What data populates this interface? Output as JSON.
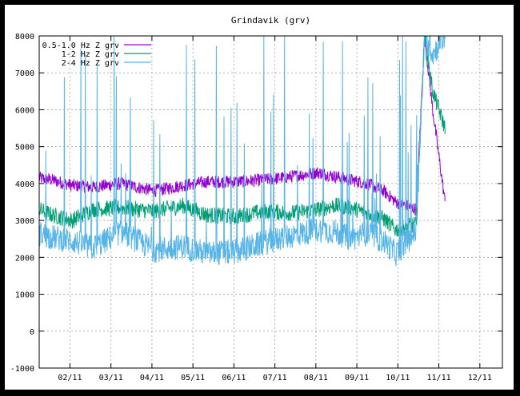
{
  "chart_data": {
    "type": "line",
    "title": "Grindavik (grv)",
    "xlabel": "",
    "ylabel": "",
    "ylim": [
      -1000,
      8000
    ],
    "yticks": [
      -1000,
      0,
      1000,
      2000,
      3000,
      4000,
      5000,
      6000,
      7000,
      8000
    ],
    "xlim": [
      0,
      11.3
    ],
    "xticks": [
      {
        "value": 0.75,
        "label": "02/11"
      },
      {
        "value": 1.75,
        "label": "03/11"
      },
      {
        "value": 2.75,
        "label": "04/11"
      },
      {
        "value": 3.75,
        "label": "05/11"
      },
      {
        "value": 4.75,
        "label": "06/11"
      },
      {
        "value": 5.75,
        "label": "07/11"
      },
      {
        "value": 6.75,
        "label": "08/11"
      },
      {
        "value": 7.75,
        "label": "09/11"
      },
      {
        "value": 8.75,
        "label": "10/11"
      },
      {
        "value": 9.75,
        "label": "11/11"
      },
      {
        "value": 10.75,
        "label": "12/11"
      }
    ],
    "grid": true,
    "legend_position": "top-left",
    "series": [
      {
        "name": "0.5-1.0 Hz Z grv",
        "color": "#9400d3",
        "x": [
          0,
          0.3,
          0.8,
          1.3,
          2.0,
          2.8,
          3.5,
          4.1,
          4.8,
          5.5,
          6.2,
          6.8,
          7.2,
          7.6,
          8.0,
          8.4,
          8.7,
          9.2,
          9.4,
          9.6,
          9.9
        ],
        "y": [
          4150,
          4100,
          3950,
          3900,
          4000,
          3800,
          3950,
          4050,
          4050,
          4100,
          4200,
          4300,
          4200,
          4100,
          4000,
          3800,
          3500,
          3300,
          8000,
          6000,
          3500
        ]
      },
      {
        "name": "1-2 Hz Z grv",
        "color": "#009e73",
        "x": [
          0,
          0.3,
          0.8,
          1.3,
          2.0,
          2.8,
          3.5,
          4.1,
          4.8,
          5.5,
          6.2,
          6.8,
          7.2,
          7.6,
          8.0,
          8.4,
          8.7,
          9.2,
          9.4,
          9.6,
          9.9
        ],
        "y": [
          3300,
          3150,
          3000,
          3300,
          3350,
          3250,
          3400,
          3150,
          3100,
          3250,
          3200,
          3300,
          3400,
          3350,
          3200,
          3050,
          2750,
          2900,
          8000,
          6500,
          5500
        ]
      },
      {
        "name": "2-4 Hz Z grv",
        "color": "#56b4e9",
        "x": [
          0,
          0.3,
          0.8,
          1.3,
          2.0,
          2.8,
          3.5,
          4.1,
          4.8,
          5.5,
          6.2,
          6.8,
          7.2,
          7.6,
          8.0,
          8.4,
          8.7,
          9.2,
          9.4,
          9.6,
          9.9
        ],
        "y": [
          2650,
          2550,
          2450,
          2250,
          2700,
          2200,
          2300,
          2100,
          2150,
          2400,
          2600,
          2750,
          2700,
          2500,
          2650,
          2450,
          2100,
          2700,
          8000,
          7500,
          8000
        ]
      }
    ]
  }
}
